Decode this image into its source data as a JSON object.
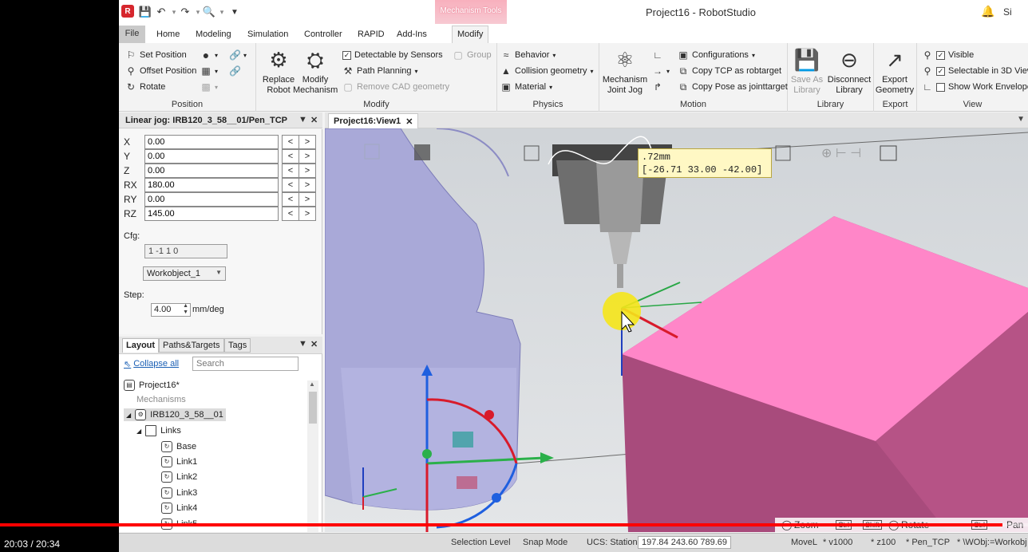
{
  "window": {
    "title": "Project16 - RobotStudio",
    "contextual_group": "Mechanism Tools",
    "signin": "Si"
  },
  "ribbon_tabs": [
    "File",
    "Home",
    "Modeling",
    "Simulation",
    "Controller",
    "RAPID",
    "Add-Ins",
    "Modify"
  ],
  "ribbon": {
    "position": {
      "label": "Position",
      "set_position": "Set Position",
      "offset_position": "Offset Position",
      "rotate": "Rotate"
    },
    "modify": {
      "label": "Modify",
      "replace_robot": "Replace Robot",
      "modify_mechanism": "Modify Mechanism",
      "detectable_by_sensors": "Detectable by Sensors",
      "group": "Group",
      "path_planning": "Path Planning",
      "remove_cad_geometry": "Remove CAD geometry"
    },
    "physics": {
      "label": "Physics",
      "behavior": "Behavior",
      "collision_geometry": "Collision geometry",
      "material": "Material"
    },
    "motion": {
      "label": "Motion",
      "mechanism_joint_jog": "Mechanism Joint Jog",
      "configurations": "Configurations",
      "copy_tcp": "Copy TCP as robtarget",
      "copy_pose": "Copy Pose as jointtarget"
    },
    "library": {
      "label": "Library",
      "save_as_library": "Save As Library",
      "disconnect_library": "Disconnect Library"
    },
    "export": {
      "label": "Export",
      "export_geometry": "Export Geometry"
    },
    "view": {
      "label": "View",
      "visible": "Visible",
      "selectable": "Selectable in 3D View",
      "show_work_envelope": "Show Work Envelope"
    }
  },
  "jog_panel": {
    "title": "Linear jog: IRB120_3_58__01/Pen_TCP",
    "rows": [
      {
        "label": "X",
        "value": "0.00"
      },
      {
        "label": "Y",
        "value": "0.00"
      },
      {
        "label": "Z",
        "value": "0.00"
      },
      {
        "label": "RX",
        "value": "180.00"
      },
      {
        "label": "RY",
        "value": "0.00"
      },
      {
        "label": "RZ",
        "value": "145.00"
      }
    ],
    "dec": "<",
    "inc": ">",
    "cfg_label": "Cfg:",
    "cfg_value": "1 -1 1 0",
    "workobject": "Workobject_1",
    "step_label": "Step:",
    "step_value": "4.00",
    "step_unit": "mm/deg"
  },
  "layout_panel": {
    "tabs": [
      "Layout",
      "Paths&Targets",
      "Tags"
    ],
    "collapse_all": "Collapse all",
    "search_placeholder": "Search",
    "tree": {
      "project": "Project16*",
      "mechanisms_header": "Mechanisms",
      "robot": "IRB120_3_58__01",
      "links": "Links",
      "items": [
        "Base",
        "Link1",
        "Link2",
        "Link3",
        "Link4",
        "Link5"
      ]
    }
  },
  "viewport": {
    "tab": "Project16:View1",
    "tooltip_line1": ".72mm",
    "tooltip_line2": "[-26.71 33.00 -42.00]"
  },
  "statusbar": {
    "selection_level": "Selection Level",
    "snap_mode": "Snap Mode",
    "ucs": "UCS: Station",
    "coords": "197.84  243.60  789.69",
    "move": "MoveL",
    "speed": "* v1000",
    "zone": "* z100",
    "tool": "* Pen_TCP",
    "wobj": "* \\WObj:=Workobj"
  },
  "nav_hints": {
    "zoom": "Zoom",
    "rotate": "Rotate",
    "pan": "Pan",
    "ctrl": "Ctrl",
    "shift": "Shift"
  },
  "video": {
    "time": "20:03 / 20:34",
    "progress": 0.975
  },
  "colors": {
    "accent": "#d6262d",
    "box": "#ff85c6",
    "robot": "#a9a9d8"
  }
}
